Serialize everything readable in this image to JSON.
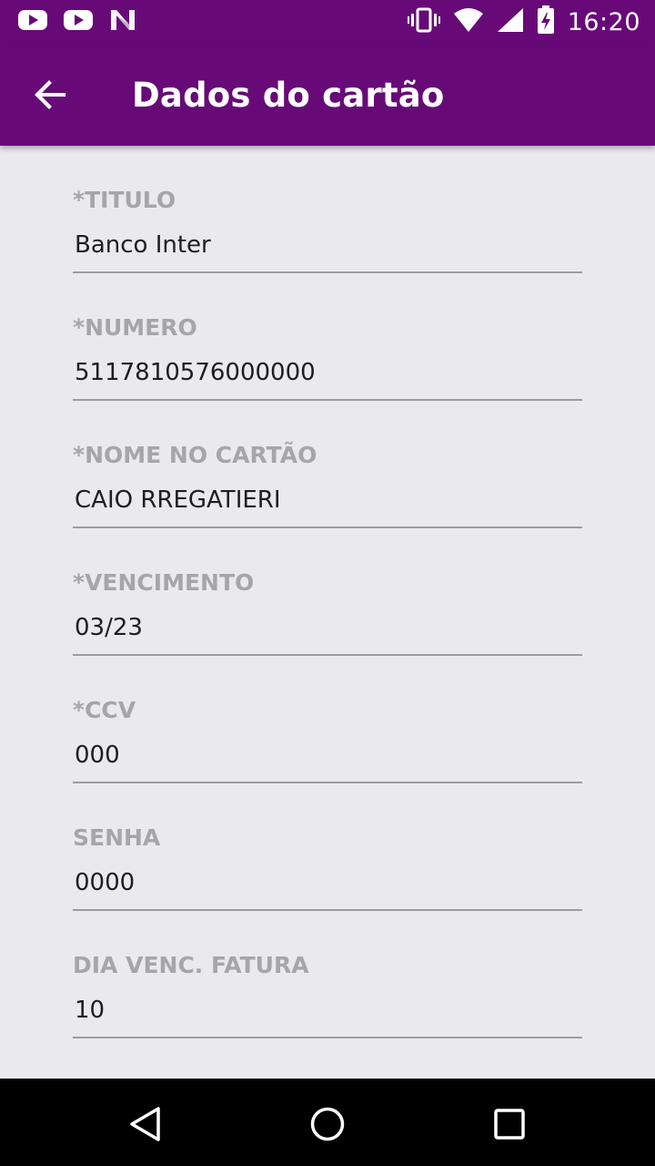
{
  "status_bar": {
    "time": "16:20",
    "left_icons": [
      "youtube-icon",
      "youtube-icon",
      "n-logo-icon"
    ],
    "right_icons": [
      "vibrate-icon",
      "wifi-icon",
      "signal-icon",
      "battery-charging-icon"
    ]
  },
  "app_bar": {
    "title": "Dados do cartão",
    "back_icon": "arrow-back-icon"
  },
  "form": {
    "fields": [
      {
        "label": "*TITULO",
        "value": "Banco Inter"
      },
      {
        "label": "*NUMERO",
        "value": "5117810576000000"
      },
      {
        "label": "*NOME NO CARTÃO",
        "value": "CAIO RREGATIERI"
      },
      {
        "label": "*VENCIMENTO",
        "value": "03/23"
      },
      {
        "label": "*CCV",
        "value": "000"
      },
      {
        "label": "SENHA",
        "value": "0000"
      },
      {
        "label": "DIA VENC. FATURA",
        "value": "10"
      }
    ]
  },
  "nav_bar": {
    "buttons": [
      "back-triangle-icon",
      "home-circle-icon",
      "recents-square-icon"
    ]
  },
  "colors": {
    "primary": "#670a78",
    "background": "#e9e9ee",
    "label": "#a6a6a9",
    "text": "#1e1e1e",
    "underline": "#9c9ca0"
  }
}
